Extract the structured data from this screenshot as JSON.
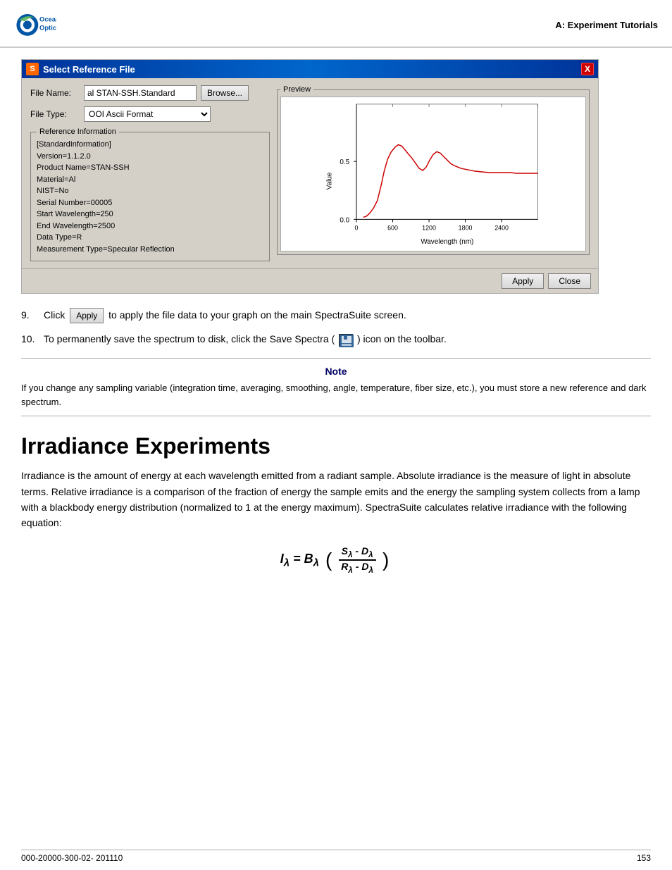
{
  "header": {
    "logo_text": "Ocean\nOptics",
    "section_label": "A: Experiment Tutorials"
  },
  "dialog": {
    "title": "Select Reference File",
    "close_btn_label": "X",
    "file_name_label": "File Name:",
    "file_name_value": "al STAN-SSH.Standard",
    "browse_btn_label": "Browse...",
    "file_type_label": "File Type:",
    "file_type_value": "OOI Ascii Format",
    "ref_info_group_label": "Reference Information",
    "ref_info_lines": [
      "[StandardInformation]",
      "Version=1.1.2.0",
      "Product Name=STAN-SSH",
      "Material=Al",
      "NIST=No",
      "Serial Number=00005",
      "Start Wavelength=250",
      "End Wavelength=2500",
      "Data Type=R",
      "Measurement Type=Specular Reflection"
    ],
    "preview_label": "Preview",
    "apply_btn": "Apply",
    "close_btn": "Close"
  },
  "chart": {
    "y_label": "Value",
    "y_tick_top": "0.5",
    "y_tick_bottom": "0.0",
    "x_label": "Wavelength (nm)",
    "x_ticks": [
      "0",
      "600",
      "1200",
      "1800",
      "2400"
    ]
  },
  "steps": [
    {
      "number": "9.",
      "text_before": "Click ",
      "btn_label": "Apply",
      "text_after": "to apply the file data to your graph on the main SpectraSuite screen."
    },
    {
      "number": "10.",
      "text": "To permanently save the spectrum to disk, click the Save Spectra (",
      "text_after": ") icon on the toolbar."
    }
  ],
  "note": {
    "title": "Note",
    "content": "If you change any sampling variable (integration time, averaging, smoothing, angle, temperature, fiber size, etc.), you must store a new reference and dark spectrum."
  },
  "section": {
    "heading": "Irradiance Experiments",
    "body": "Irradiance is the amount of energy at each wavelength emitted from a radiant sample. Absolute irradiance is the measure of light in absolute terms. Relative irradiance is a comparison of the fraction of energy the sample emits and the energy the sampling system collects from a lamp with a blackbody energy distribution (normalized to 1 at the energy maximum). SpectraSuite calculates relative irradiance with the following equation:"
  },
  "equation": {
    "display": "Iλ = Bλ  ( Sλ - Dλ / Rλ - Dλ )"
  },
  "footer": {
    "left": "000-20000-300-02-  201110",
    "right": "153"
  }
}
